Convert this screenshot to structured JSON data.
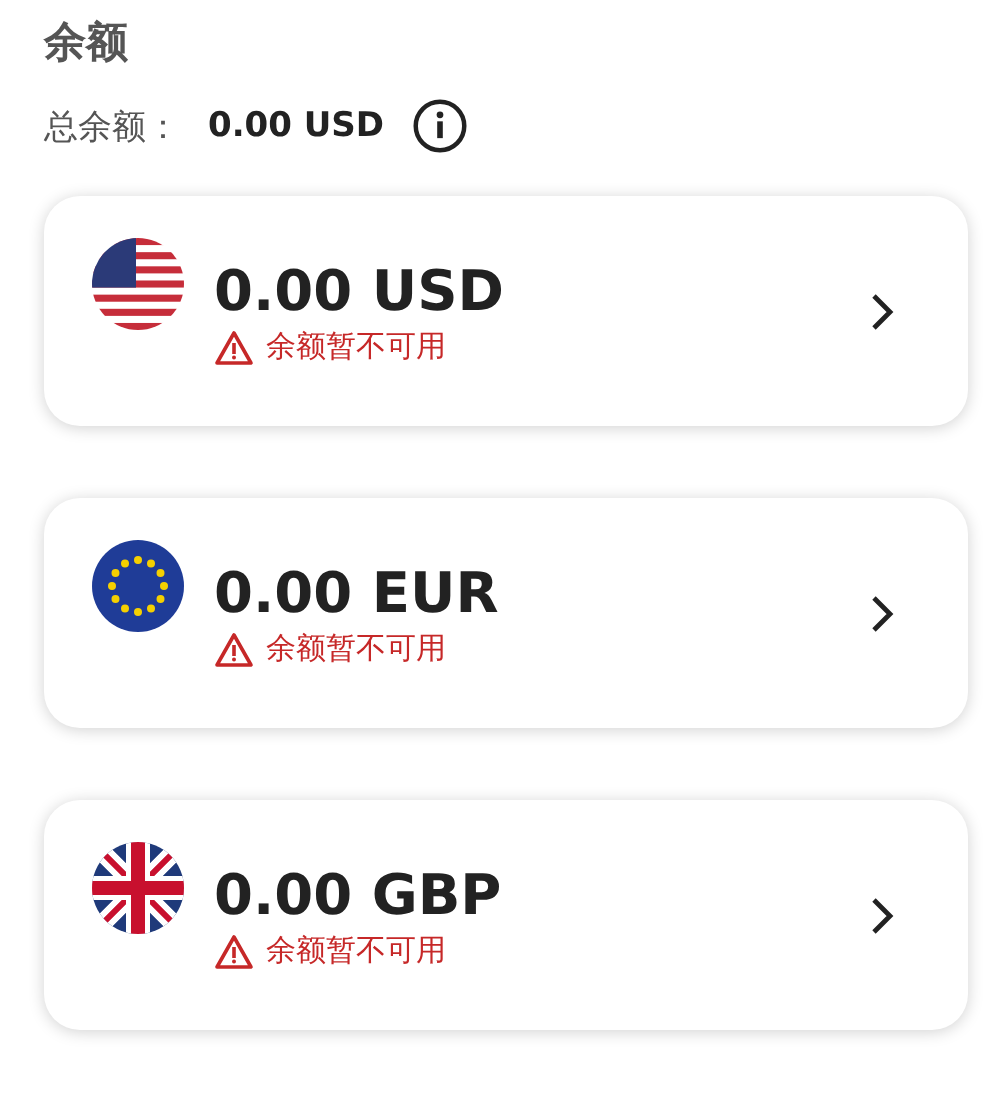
{
  "title": "余额",
  "total": {
    "label": "总余额：",
    "value": "0.00 USD"
  },
  "accounts": [
    {
      "kind": "us",
      "amount": "0.00 USD",
      "warning": "余额暂不可用"
    },
    {
      "kind": "eu",
      "amount": "0.00 EUR",
      "warning": "余额暂不可用"
    },
    {
      "kind": "gb",
      "amount": "0.00 GBP",
      "warning": "余额暂不可用"
    }
  ]
}
